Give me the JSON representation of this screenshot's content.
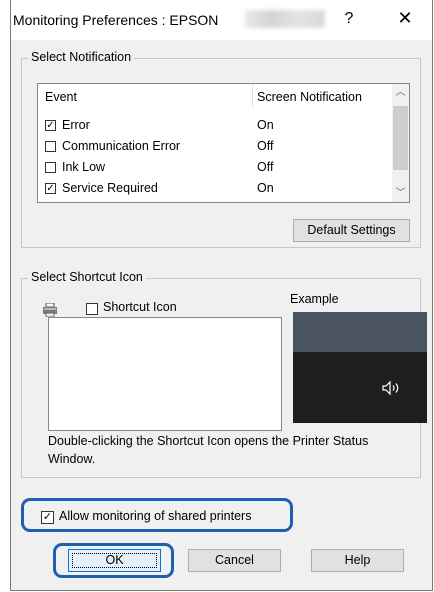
{
  "window": {
    "title": "Monitoring Preferences : EPSON",
    "help_label": "?",
    "close_label": "✕"
  },
  "select_notification": {
    "legend": "Select Notification",
    "columns": {
      "event": "Event",
      "screen": "Screen Notification"
    },
    "rows": [
      {
        "event": "Error",
        "checked": true,
        "screen": "On"
      },
      {
        "event": "Communication Error",
        "checked": false,
        "screen": "Off"
      },
      {
        "event": "Ink Low",
        "checked": false,
        "screen": "Off"
      },
      {
        "event": "Service Required",
        "checked": true,
        "screen": "On"
      }
    ],
    "default_button": "Default Settings"
  },
  "shortcut": {
    "legend": "Select Shortcut Icon",
    "checkbox_label": "Shortcut Icon",
    "example_label": "Example",
    "description": "Double-clicking the Shortcut Icon opens the Printer Status Window."
  },
  "allow_shared": {
    "label": "Allow monitoring of shared printers",
    "checked": true
  },
  "buttons": {
    "ok": "OK",
    "cancel": "Cancel",
    "help": "Help"
  },
  "colors": {
    "highlight": "#1f5fb1",
    "dialog_bg": "#f0f0f0"
  },
  "icons": [
    "printer-icon",
    "speaker-icon",
    "scroll-up-icon",
    "scroll-down-icon"
  ]
}
